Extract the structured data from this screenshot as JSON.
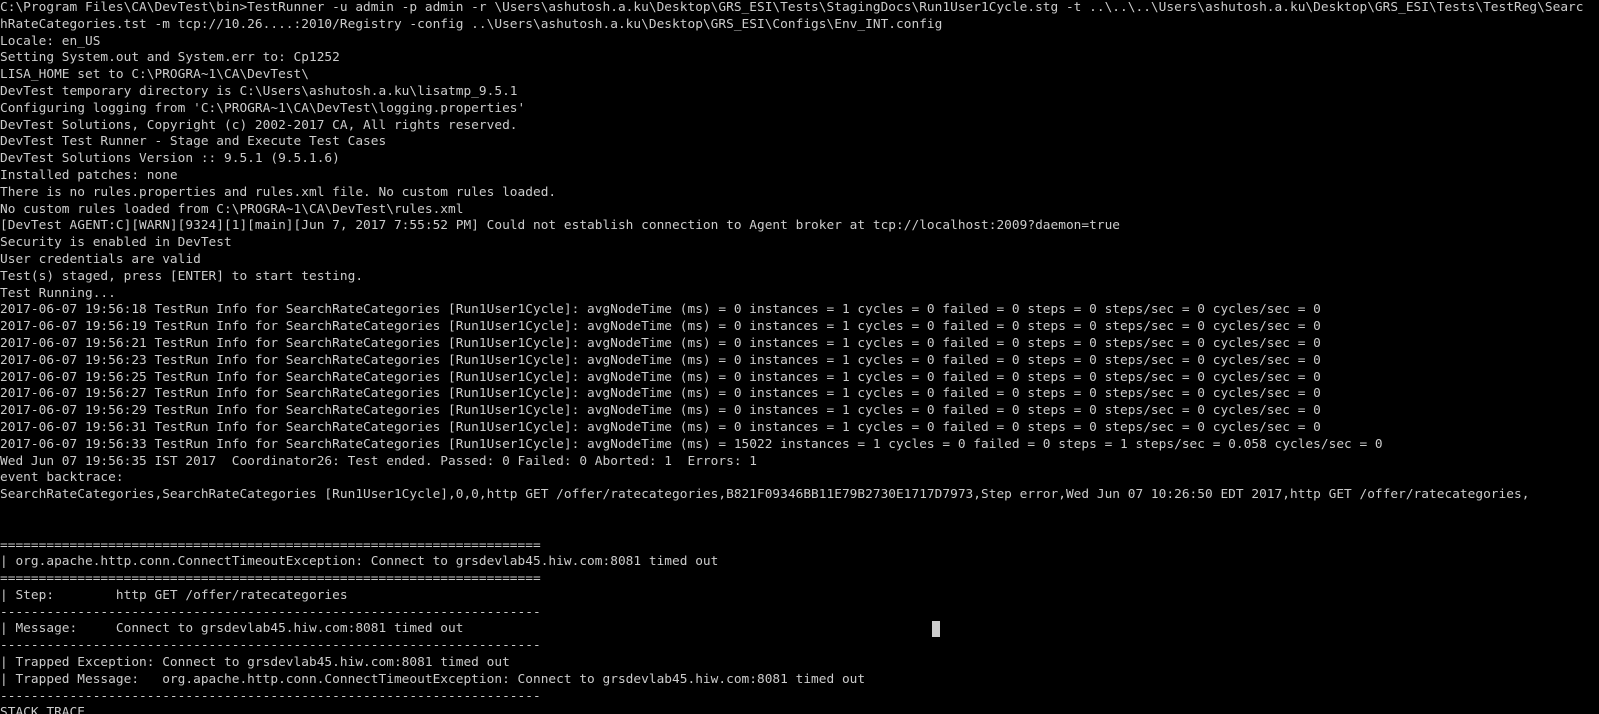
{
  "console": {
    "lines": [
      "C:\\Program Files\\CA\\DevTest\\bin>TestRunner -u admin -p admin -r \\Users\\ashutosh.a.ku\\Desktop\\GRS_ESI\\Tests\\StagingDocs\\Run1User1Cycle.stg -t ..\\..\\..\\Users\\ashutosh.a.ku\\Desktop\\GRS_ESI\\Tests\\TestReg\\Searc",
      "hRateCategories.tst -m tcp://10.26....:2010/Registry -config ..\\Users\\ashutosh.a.ku\\Desktop\\GRS_ESI\\Configs\\Env_INT.config",
      "Locale: en_US",
      "Setting System.out and System.err to: Cp1252",
      "LISA_HOME set to C:\\PROGRA~1\\CA\\DevTest\\",
      "DevTest temporary directory is C:\\Users\\ashutosh.a.ku\\lisatmp_9.5.1",
      "Configuring logging from 'C:\\PROGRA~1\\CA\\DevTest\\logging.properties'",
      "DevTest Solutions, Copyright (c) 2002-2017 CA, All rights reserved.",
      "DevTest Test Runner - Stage and Execute Test Cases",
      "DevTest Solutions Version :: 9.5.1 (9.5.1.6)",
      "Installed patches: none",
      "There is no rules.properties and rules.xml file. No custom rules loaded.",
      "No custom rules loaded from C:\\PROGRA~1\\CA\\DevTest\\rules.xml",
      "[DevTest AGENT:C][WARN][9324][1][main][Jun 7, 2017 7:55:52 PM] Could not establish connection to Agent broker at tcp://localhost:2009?daemon=true",
      "Security is enabled in DevTest",
      "User credentials are valid",
      "Test(s) staged, press [ENTER] to start testing.",
      "Test Running...",
      "2017-06-07 19:56:18 TestRun Info for SearchRateCategories [Run1User1Cycle]: avgNodeTime (ms) = 0 instances = 1 cycles = 0 failed = 0 steps = 0 steps/sec = 0 cycles/sec = 0",
      "2017-06-07 19:56:19 TestRun Info for SearchRateCategories [Run1User1Cycle]: avgNodeTime (ms) = 0 instances = 1 cycles = 0 failed = 0 steps = 0 steps/sec = 0 cycles/sec = 0",
      "2017-06-07 19:56:21 TestRun Info for SearchRateCategories [Run1User1Cycle]: avgNodeTime (ms) = 0 instances = 1 cycles = 0 failed = 0 steps = 0 steps/sec = 0 cycles/sec = 0",
      "2017-06-07 19:56:23 TestRun Info for SearchRateCategories [Run1User1Cycle]: avgNodeTime (ms) = 0 instances = 1 cycles = 0 failed = 0 steps = 0 steps/sec = 0 cycles/sec = 0",
      "2017-06-07 19:56:25 TestRun Info for SearchRateCategories [Run1User1Cycle]: avgNodeTime (ms) = 0 instances = 1 cycles = 0 failed = 0 steps = 0 steps/sec = 0 cycles/sec = 0",
      "2017-06-07 19:56:27 TestRun Info for SearchRateCategories [Run1User1Cycle]: avgNodeTime (ms) = 0 instances = 1 cycles = 0 failed = 0 steps = 0 steps/sec = 0 cycles/sec = 0",
      "2017-06-07 19:56:29 TestRun Info for SearchRateCategories [Run1User1Cycle]: avgNodeTime (ms) = 0 instances = 1 cycles = 0 failed = 0 steps = 0 steps/sec = 0 cycles/sec = 0",
      "2017-06-07 19:56:31 TestRun Info for SearchRateCategories [Run1User1Cycle]: avgNodeTime (ms) = 0 instances = 1 cycles = 0 failed = 0 steps = 0 steps/sec = 0 cycles/sec = 0",
      "2017-06-07 19:56:33 TestRun Info for SearchRateCategories [Run1User1Cycle]: avgNodeTime (ms) = 15022 instances = 1 cycles = 0 failed = 0 steps = 1 steps/sec = 0.058 cycles/sec = 0",
      "Wed Jun 07 19:56:35 IST 2017  Coordinator26: Test ended. Passed: 0 Failed: 0 Aborted: 1  Errors: 1",
      "event backtrace:",
      "SearchRateCategories,SearchRateCategories [Run1User1Cycle],0,0,http GET /offer/ratecategories,B821F09346BB11E79B2730E1717D7973,Step error,Wed Jun 07 10:26:50 EDT 2017,http GET /offer/ratecategories,",
      "",
      "",
      "======================================================================",
      "| org.apache.http.conn.ConnectTimeoutException: Connect to grsdevlab45.hiw.com:8081 timed out",
      "======================================================================",
      "| Step:        http GET /offer/ratecategories",
      "----------------------------------------------------------------------",
      "| Message:     Connect to grsdevlab45.hiw.com:8081 timed out",
      "----------------------------------------------------------------------",
      "| Trapped Exception: Connect to grsdevlab45.hiw.com:8081 timed out",
      "| Trapped Message:   org.apache.http.conn.ConnectTimeoutException: Connect to grsdevlab45.hiw.com:8081 timed out",
      "----------------------------------------------------------------------",
      "STACK TRACE"
    ]
  }
}
